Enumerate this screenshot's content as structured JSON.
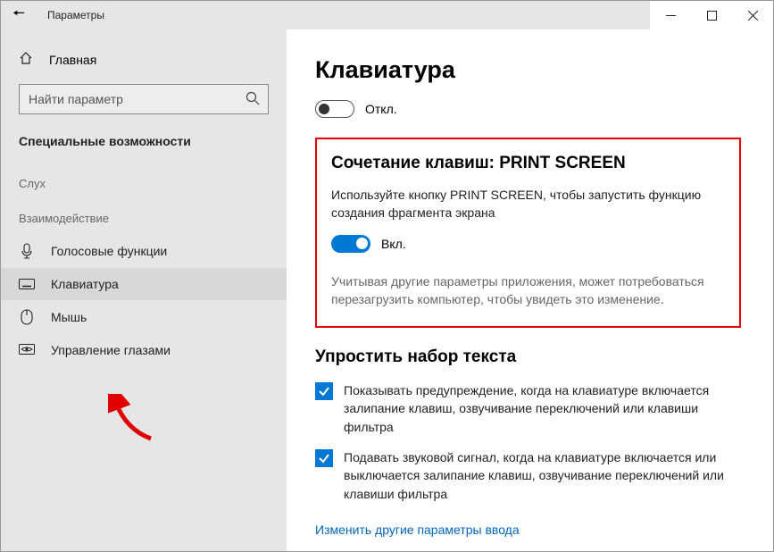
{
  "titlebar": {
    "title": "Параметры"
  },
  "sidebar": {
    "home": "Главная",
    "search_placeholder": "Найти параметр",
    "category": "Специальные возможности",
    "group_hearing": "Слух",
    "group_interaction": "Взаимодействие",
    "items": [
      {
        "label": "Голосовые функции"
      },
      {
        "label": "Клавиатура"
      },
      {
        "label": "Мышь"
      },
      {
        "label": "Управление глазами"
      }
    ]
  },
  "main": {
    "title": "Клавиатура",
    "top_toggle_label": "Откл.",
    "section1": {
      "heading": "Сочетание клавиш: PRINT SCREEN",
      "desc": "Используйте кнопку PRINT SCREEN, чтобы запустить функцию создания фрагмента экрана",
      "toggle_label": "Вкл.",
      "note": "Учитывая другие параметры приложения, может потребоваться перезагрузить компьютер, чтобы увидеть это изменение."
    },
    "section2": {
      "heading": "Упростить набор текста",
      "checks": [
        "Показывать предупреждение, когда на клавиатуре включается залипание клавиш, озвучивание переключений или клавиши фильтра",
        "Подавать звуковой сигнал, когда на клавиатуре включается или выключается залипание клавиш, озвучивание переключений или клавиши фильтра"
      ],
      "link": "Изменить другие параметры ввода"
    }
  }
}
